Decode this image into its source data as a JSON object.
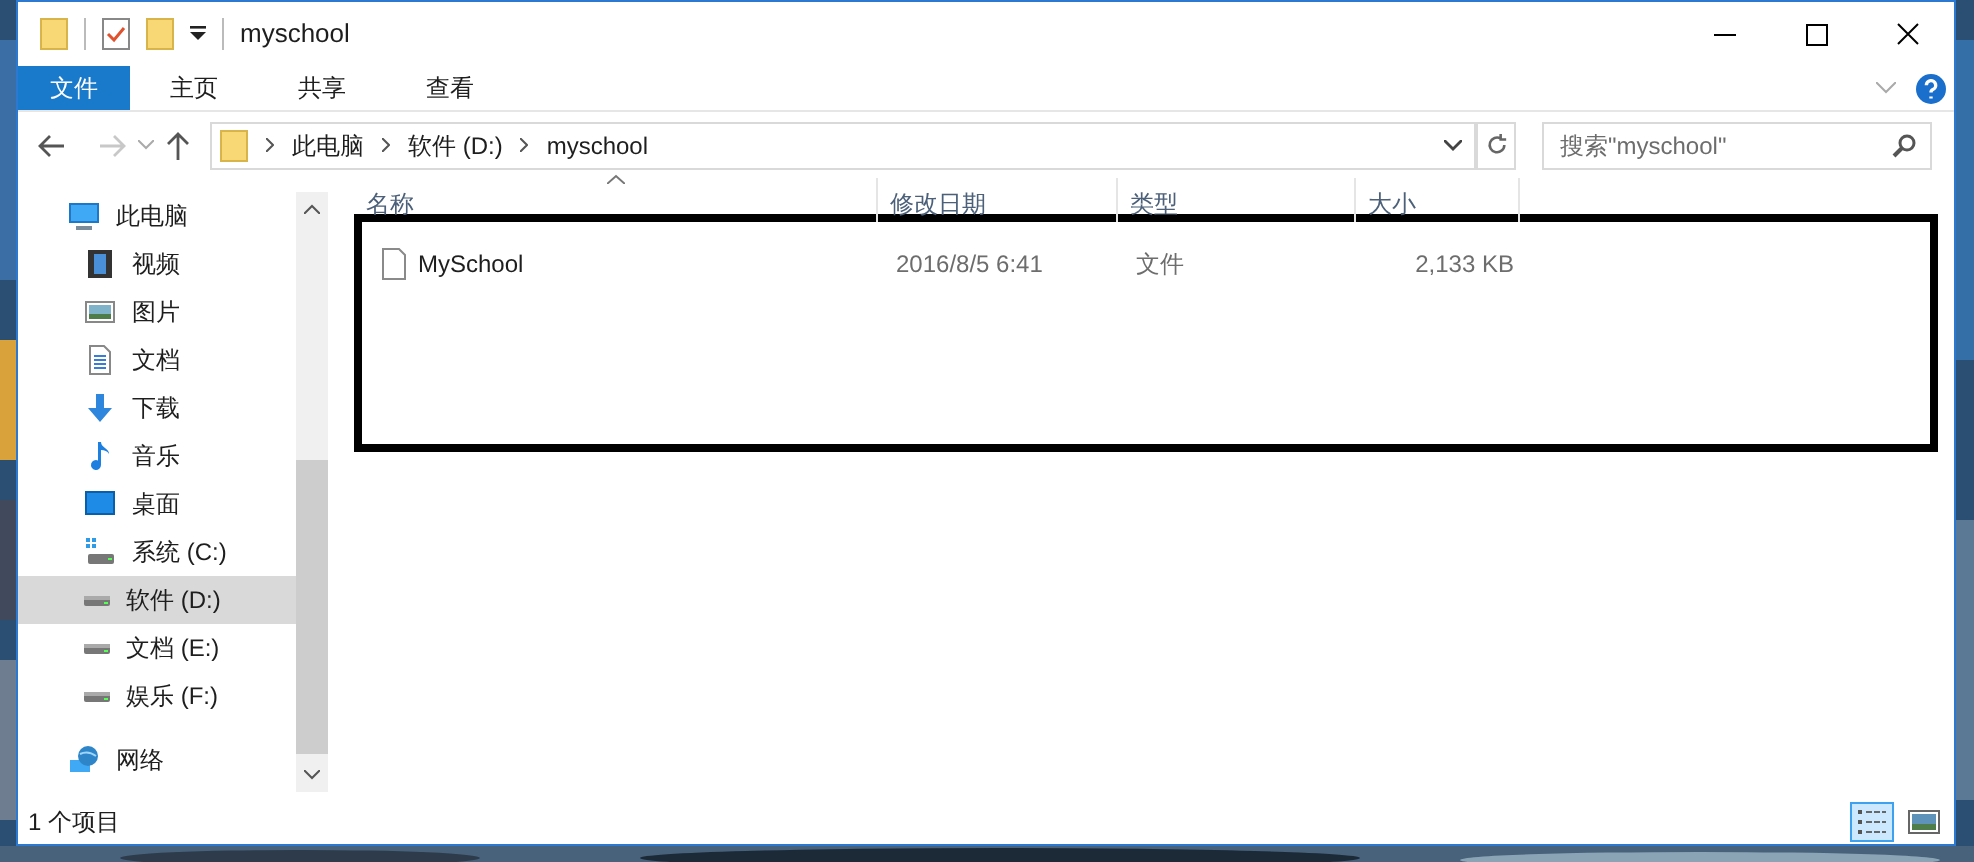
{
  "window": {
    "title": "myschool"
  },
  "ribbon_tabs": [
    {
      "label": "文件",
      "kind": "file"
    },
    {
      "label": "主页",
      "kind": "tab"
    },
    {
      "label": "共享",
      "kind": "tab"
    },
    {
      "label": "查看",
      "kind": "tab"
    }
  ],
  "address_bar": {
    "path": [
      "此电脑",
      "软件 (D:)",
      "myschool"
    ]
  },
  "search": {
    "placeholder": "搜索\"myschool\""
  },
  "sidebar": {
    "items": [
      {
        "label": "此电脑",
        "kind": "computer",
        "selected": false,
        "children": [
          {
            "label": "视频",
            "kind": "video",
            "selected": false
          },
          {
            "label": "图片",
            "kind": "pictures",
            "selected": false
          },
          {
            "label": "文档",
            "kind": "documents",
            "selected": false
          },
          {
            "label": "下载",
            "kind": "downloads",
            "selected": false
          },
          {
            "label": "音乐",
            "kind": "music",
            "selected": false
          },
          {
            "label": "桌面",
            "kind": "desktop",
            "selected": false
          },
          {
            "label": "系统 (C:)",
            "kind": "system-drive",
            "selected": false
          },
          {
            "label": "软件 (D:)",
            "kind": "drive",
            "selected": true
          },
          {
            "label": "文档 (E:)",
            "kind": "drive",
            "selected": false
          },
          {
            "label": "娱乐 (F:)",
            "kind": "drive",
            "selected": false
          }
        ]
      },
      {
        "label": "网络",
        "kind": "network",
        "selected": false
      }
    ]
  },
  "table": {
    "columns": [
      {
        "label": "名称",
        "sorted": true
      },
      {
        "label": "修改日期",
        "sorted": false
      },
      {
        "label": "类型",
        "sorted": false
      },
      {
        "label": "大小",
        "sorted": false
      }
    ],
    "rows": [
      {
        "name": "MySchool",
        "date": "2016/8/5 6:41",
        "type": "文件",
        "size": "2,133 KB"
      }
    ]
  },
  "status_bar": {
    "text": "1 个项目"
  },
  "view_buttons": [
    {
      "kind": "details",
      "selected": true
    },
    {
      "kind": "large-icons",
      "selected": false
    }
  ]
}
